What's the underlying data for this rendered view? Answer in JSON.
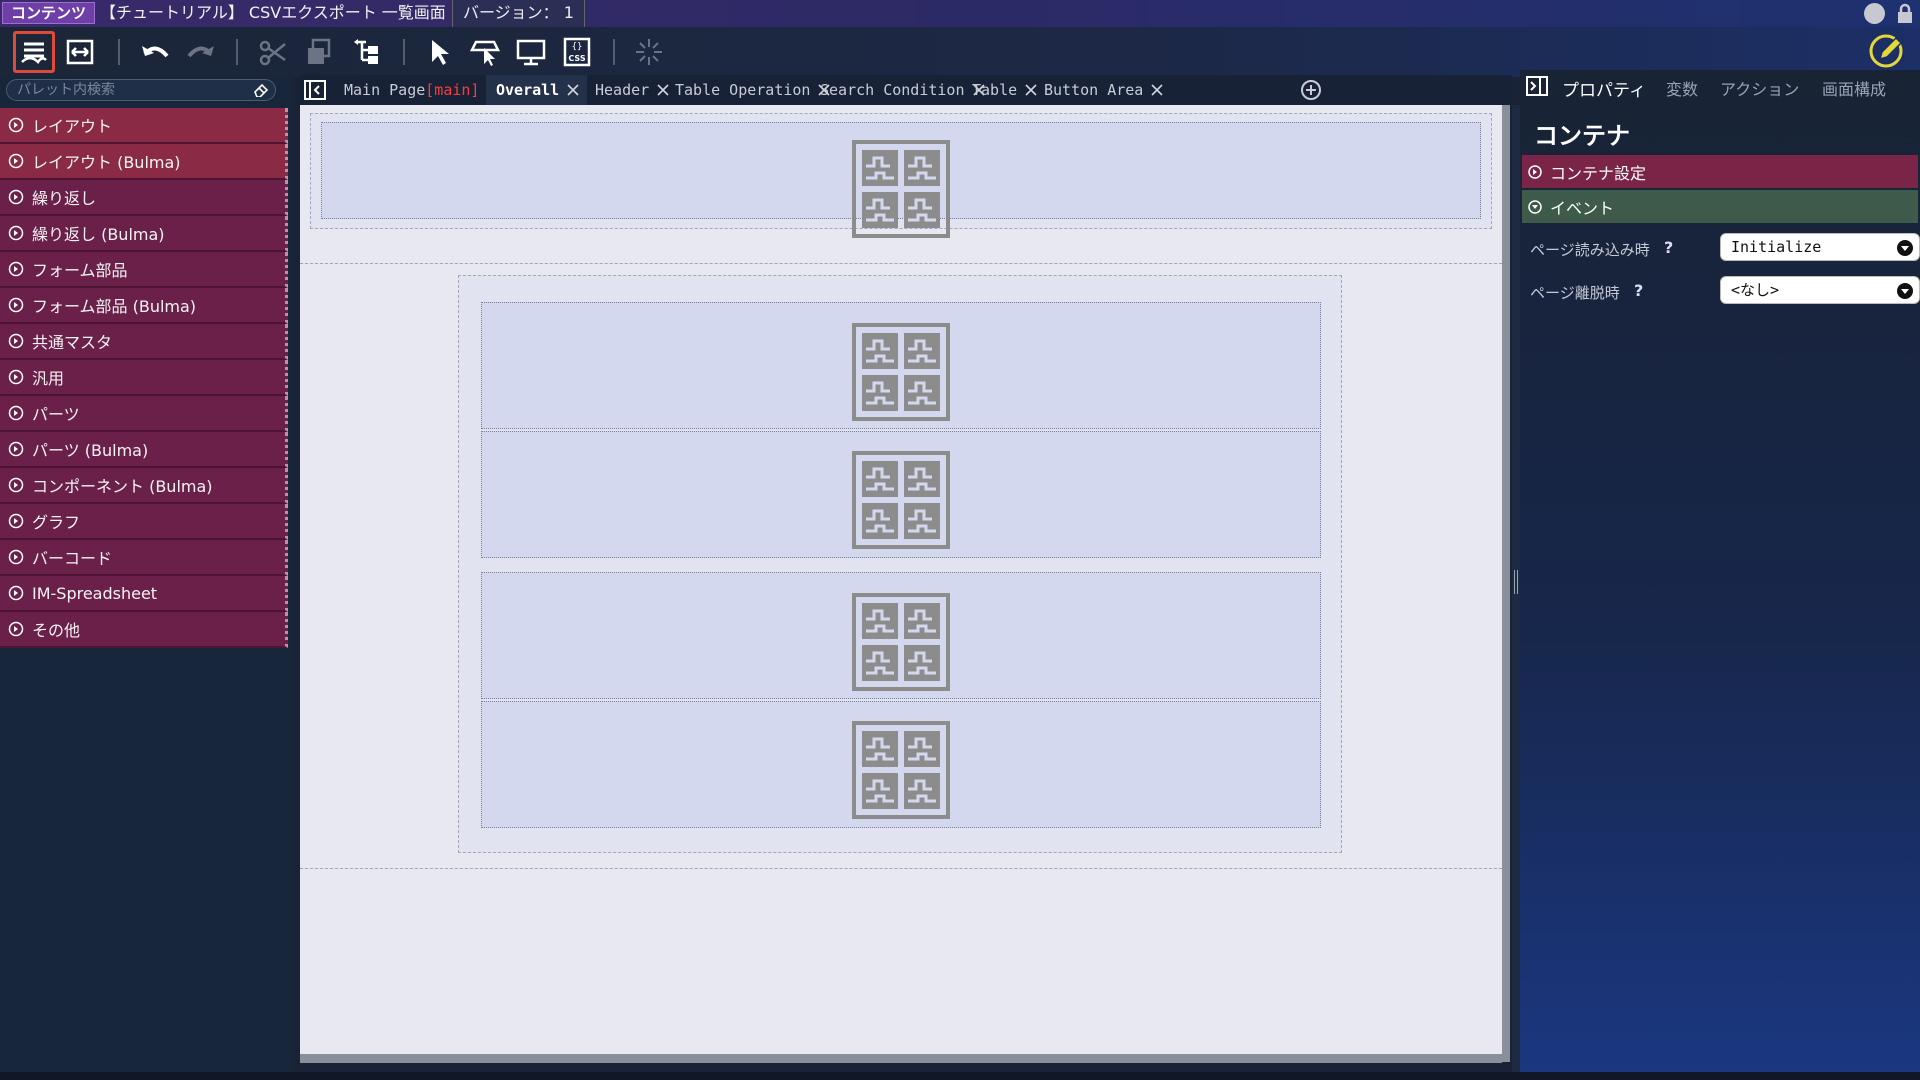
{
  "titlebar": {
    "mode": "コンテンツ",
    "title": "【チュートリアル】 CSVエクスポート 一覧画面",
    "version": "バージョン： 1"
  },
  "toolbar": {
    "icons": [
      "palette-icon",
      "resize-icon",
      "undo-icon",
      "redo-icon",
      "cut-icon",
      "copy-icon",
      "tree-icon",
      "select-pointer-icon",
      "insert-pointer-icon",
      "preview-icon",
      "css-icon",
      "sparkle-icon",
      "edit-pencil-icon"
    ],
    "css_label": "CSS",
    "accent": "#e04a3a"
  },
  "palette": {
    "search_placeholder": "パレット内検索",
    "items": [
      {
        "label": "レイアウト",
        "style": "red"
      },
      {
        "label": "レイアウト (Bulma)",
        "style": "red"
      },
      {
        "label": "繰り返し",
        "style": "plum"
      },
      {
        "label": "繰り返し (Bulma)",
        "style": "plum"
      },
      {
        "label": "フォーム部品",
        "style": "plum"
      },
      {
        "label": "フォーム部品 (Bulma)",
        "style": "plum"
      },
      {
        "label": "共通マスタ",
        "style": "plum"
      },
      {
        "label": "汎用",
        "style": "plum"
      },
      {
        "label": "パーツ",
        "style": "plum"
      },
      {
        "label": "パーツ (Bulma)",
        "style": "plum"
      },
      {
        "label": "コンポーネント (Bulma)",
        "style": "plum"
      },
      {
        "label": "グラフ",
        "style": "plum"
      },
      {
        "label": "バーコード",
        "style": "plum"
      },
      {
        "label": "IM-Spreadsheet",
        "style": "plum"
      },
      {
        "label": "その他",
        "style": "plum"
      }
    ]
  },
  "tabs": {
    "items": [
      {
        "label": "Main Page",
        "tag": "[main]",
        "active": false,
        "closable": false
      },
      {
        "label": "Overall",
        "tag": "",
        "active": true,
        "closable": true
      },
      {
        "label": "Header",
        "tag": "",
        "active": false,
        "closable": true
      },
      {
        "label": "Table Operation",
        "tag": "",
        "active": false,
        "closable": true
      },
      {
        "label": "Search Condition",
        "tag": "",
        "active": false,
        "closable": true
      },
      {
        "label": "Table",
        "tag": "",
        "active": false,
        "closable": true
      },
      {
        "label": "Button Area",
        "tag": "",
        "active": false,
        "closable": true
      }
    ]
  },
  "properties": {
    "tabs": [
      "プロパティ",
      "変数",
      "アクション",
      "画面構成"
    ],
    "title": "コンテナ",
    "section_settings": "コンテナ設定",
    "section_events": "イベント",
    "on_load_label": "ページ読み込み時",
    "on_load_value": "Initialize",
    "on_leave_label": "ページ離脱時",
    "on_leave_value": "<なし>",
    "help": "?"
  }
}
